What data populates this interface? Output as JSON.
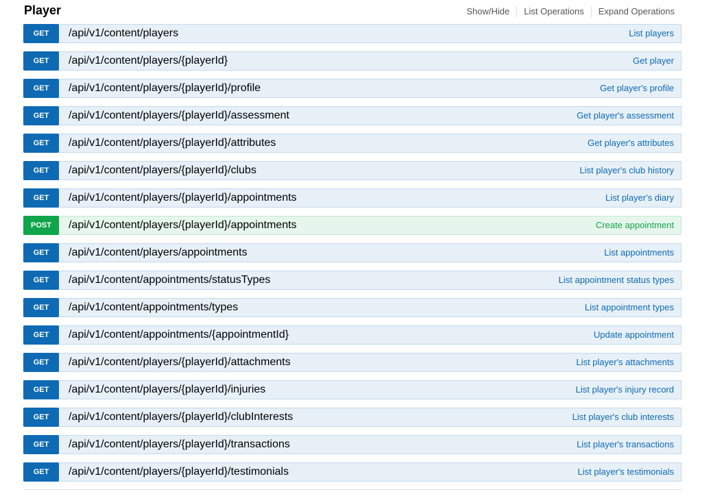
{
  "section": {
    "title": "Player"
  },
  "header_ops": [
    {
      "label": "Show/Hide"
    },
    {
      "label": "List Operations"
    },
    {
      "label": "Expand Operations"
    }
  ],
  "colors": {
    "get": "#0f6ab4",
    "post": "#10a54a"
  },
  "endpoints": [
    {
      "method": "GET",
      "path": "/api/v1/content/players",
      "summary": "List players"
    },
    {
      "method": "GET",
      "path": "/api/v1/content/players/{playerId}",
      "summary": "Get player"
    },
    {
      "method": "GET",
      "path": "/api/v1/content/players/{playerId}/profile",
      "summary": "Get player's profile"
    },
    {
      "method": "GET",
      "path": "/api/v1/content/players/{playerId}/assessment",
      "summary": "Get player's assessment"
    },
    {
      "method": "GET",
      "path": "/api/v1/content/players/{playerId}/attributes",
      "summary": "Get player's attributes"
    },
    {
      "method": "GET",
      "path": "/api/v1/content/players/{playerId}/clubs",
      "summary": "List player's club history"
    },
    {
      "method": "GET",
      "path": "/api/v1/content/players/{playerId}/appointments",
      "summary": "List player's diary"
    },
    {
      "method": "POST",
      "path": "/api/v1/content/players/{playerId}/appointments",
      "summary": "Create appointment"
    },
    {
      "method": "GET",
      "path": "/api/v1/content/players/appointments",
      "summary": "List appointments"
    },
    {
      "method": "GET",
      "path": "/api/v1/content/appointments/statusTypes",
      "summary": "List appointment status types"
    },
    {
      "method": "GET",
      "path": "/api/v1/content/appointments/types",
      "summary": "List appointment types"
    },
    {
      "method": "GET",
      "path": "/api/v1/content/appointments/{appointmentId}",
      "summary": "Update appointment"
    },
    {
      "method": "GET",
      "path": "/api/v1/content/players/{playerId}/attachments",
      "summary": "List player's attachments"
    },
    {
      "method": "GET",
      "path": "/api/v1/content/players/{playerId}/injuries",
      "summary": "List player's injury record"
    },
    {
      "method": "GET",
      "path": "/api/v1/content/players/{playerId}/clubInterests",
      "summary": "List player's club interests"
    },
    {
      "method": "GET",
      "path": "/api/v1/content/players/{playerId}/transactions",
      "summary": "List player's transactions"
    },
    {
      "method": "GET",
      "path": "/api/v1/content/players/{playerId}/testimonials",
      "summary": "List player's testimonials"
    }
  ]
}
